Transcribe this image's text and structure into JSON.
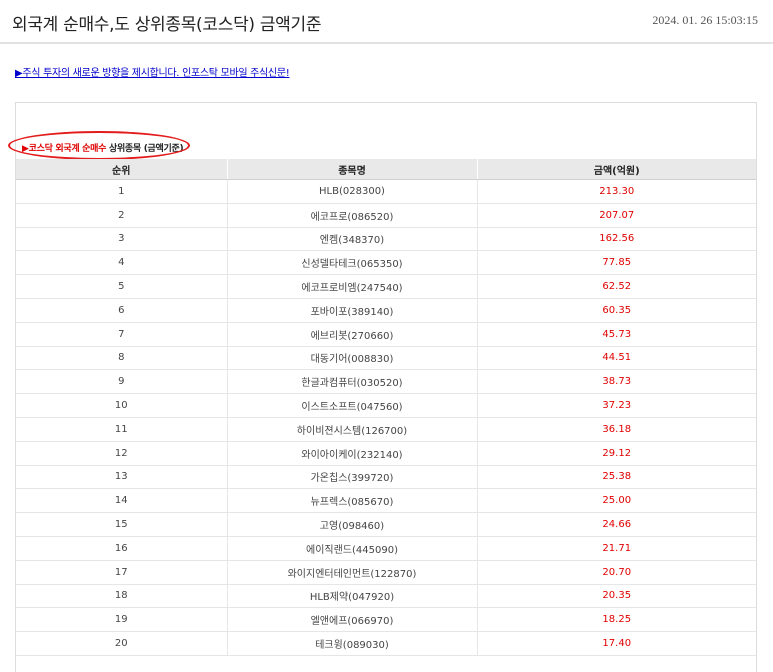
{
  "page": {
    "title": "외국계 순매수,도 상위종목(코스닥) 금액기준",
    "timestamp": "2024. 01. 26 15:03:15",
    "promo_link": "▶주식 투자의 새로운 방향을 제시합니다. 인포스탁 모바일 주식신문!"
  },
  "caption": {
    "arrow": "▶",
    "highlight": "코스닥 외국계 순매수",
    "rest": " 상위종목 (금액기준)"
  },
  "table": {
    "headers": [
      "순위",
      "종목명",
      "금액(억원)"
    ],
    "rows": [
      {
        "rank": "1",
        "name": "HLB(028300)",
        "amount": "213.30"
      },
      {
        "rank": "2",
        "name": "에코프로(086520)",
        "amount": "207.07"
      },
      {
        "rank": "3",
        "name": "엔켐(348370)",
        "amount": "162.56"
      },
      {
        "rank": "4",
        "name": "신성델타테크(065350)",
        "amount": "77.85"
      },
      {
        "rank": "5",
        "name": "에코프로비엠(247540)",
        "amount": "62.52"
      },
      {
        "rank": "6",
        "name": "포바이포(389140)",
        "amount": "60.35"
      },
      {
        "rank": "7",
        "name": "에브리봇(270660)",
        "amount": "45.73"
      },
      {
        "rank": "8",
        "name": "대동기어(008830)",
        "amount": "44.51"
      },
      {
        "rank": "9",
        "name": "한글과컴퓨터(030520)",
        "amount": "38.73"
      },
      {
        "rank": "10",
        "name": "이스트소프트(047560)",
        "amount": "37.23"
      },
      {
        "rank": "11",
        "name": "하이비젼시스템(126700)",
        "amount": "36.18"
      },
      {
        "rank": "12",
        "name": "와이아이케이(232140)",
        "amount": "29.12"
      },
      {
        "rank": "13",
        "name": "가온칩스(399720)",
        "amount": "25.38"
      },
      {
        "rank": "14",
        "name": "뉴프렉스(085670)",
        "amount": "25.00"
      },
      {
        "rank": "15",
        "name": "고영(098460)",
        "amount": "24.66"
      },
      {
        "rank": "16",
        "name": "에이직랜드(445090)",
        "amount": "21.71"
      },
      {
        "rank": "17",
        "name": "와이지엔터테인먼트(122870)",
        "amount": "20.70"
      },
      {
        "rank": "18",
        "name": "HLB제약(047920)",
        "amount": "20.35"
      },
      {
        "rank": "19",
        "name": "엘앤에프(066970)",
        "amount": "18.25"
      },
      {
        "rank": "20",
        "name": "테크윙(089030)",
        "amount": "17.40"
      }
    ]
  },
  "colors": {
    "accent_red": "#e00000",
    "annotation_oval": "#e31b1b",
    "link_blue": "#0000cc",
    "header_bg": "#e9e9e9"
  }
}
